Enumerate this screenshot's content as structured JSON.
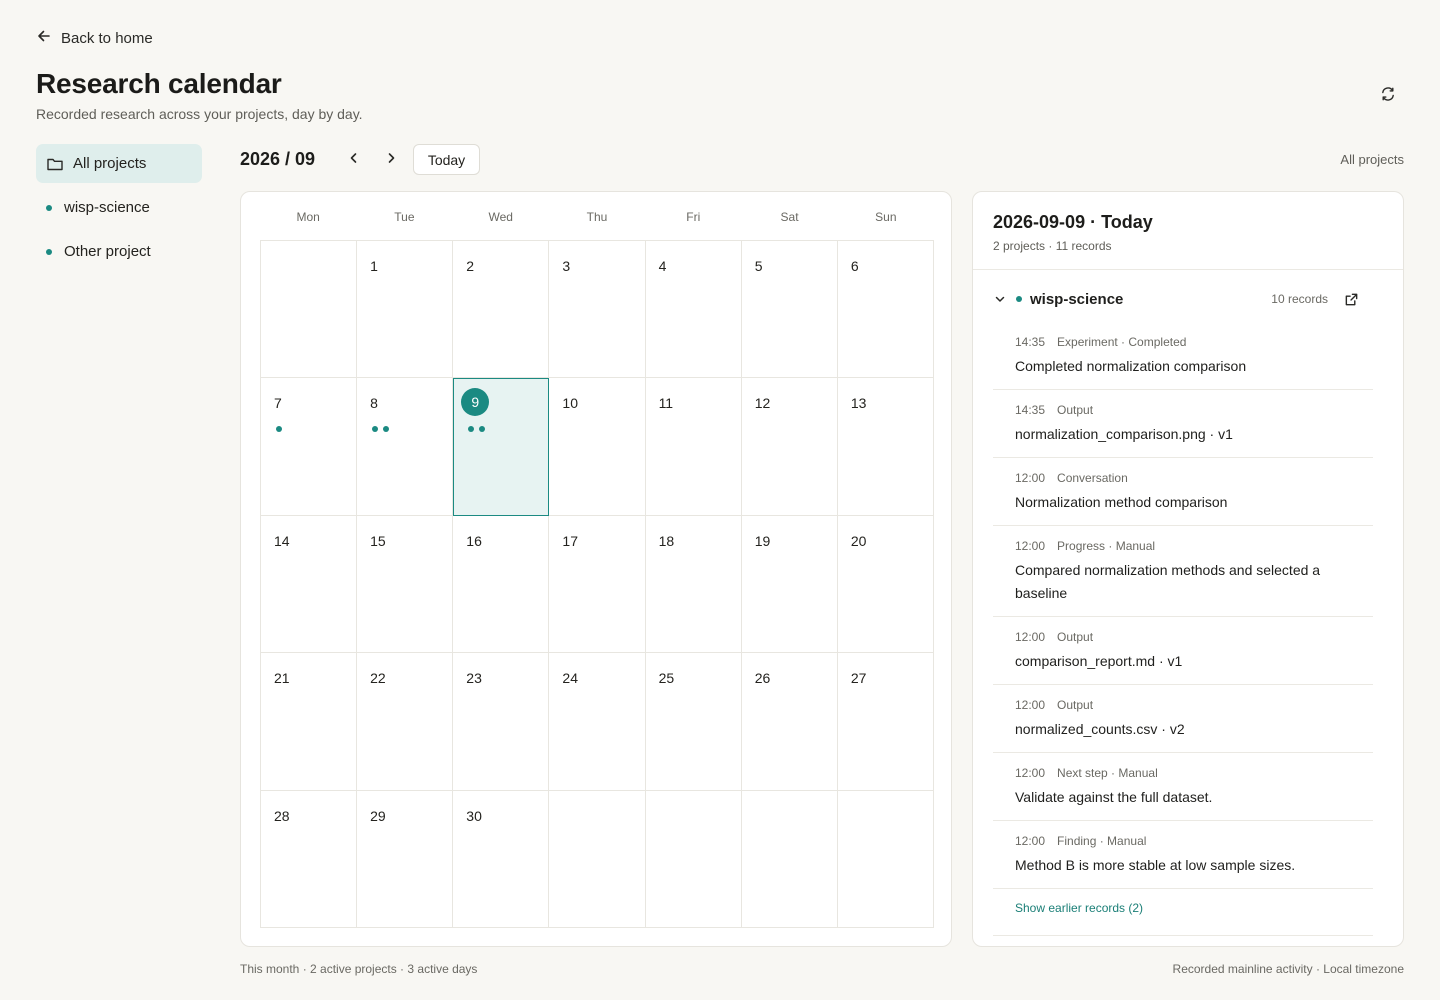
{
  "header": {
    "back_label": "Back to home",
    "title": "Research calendar",
    "subtitle": "Recorded research across your projects, day by day."
  },
  "sidebar": {
    "items": [
      {
        "label": "All projects",
        "active": true,
        "icon": "folder-icon"
      },
      {
        "label": "wisp-science",
        "active": false,
        "icon": "dot"
      },
      {
        "label": "Other project",
        "active": false,
        "icon": "dot"
      }
    ]
  },
  "toolbar": {
    "month_label": "2026 / 09",
    "today_label": "Today",
    "scope_label": "All projects"
  },
  "calendar": {
    "weekdays": [
      "Mon",
      "Tue",
      "Wed",
      "Thu",
      "Fri",
      "Sat",
      "Sun"
    ],
    "cells": [
      {
        "day": "",
        "dots": 0
      },
      {
        "day": "1",
        "dots": 0
      },
      {
        "day": "2",
        "dots": 0
      },
      {
        "day": "3",
        "dots": 0
      },
      {
        "day": "4",
        "dots": 0
      },
      {
        "day": "5",
        "dots": 0
      },
      {
        "day": "6",
        "dots": 0
      },
      {
        "day": "7",
        "dots": 1
      },
      {
        "day": "8",
        "dots": 2
      },
      {
        "day": "9",
        "dots": 2,
        "today": true,
        "selected": true
      },
      {
        "day": "10",
        "dots": 0
      },
      {
        "day": "11",
        "dots": 0
      },
      {
        "day": "12",
        "dots": 0
      },
      {
        "day": "13",
        "dots": 0
      },
      {
        "day": "14",
        "dots": 0
      },
      {
        "day": "15",
        "dots": 0
      },
      {
        "day": "16",
        "dots": 0
      },
      {
        "day": "17",
        "dots": 0
      },
      {
        "day": "18",
        "dots": 0
      },
      {
        "day": "19",
        "dots": 0
      },
      {
        "day": "20",
        "dots": 0
      },
      {
        "day": "21",
        "dots": 0
      },
      {
        "day": "22",
        "dots": 0
      },
      {
        "day": "23",
        "dots": 0
      },
      {
        "day": "24",
        "dots": 0
      },
      {
        "day": "25",
        "dots": 0
      },
      {
        "day": "26",
        "dots": 0
      },
      {
        "day": "27",
        "dots": 0
      },
      {
        "day": "28",
        "dots": 0
      },
      {
        "day": "29",
        "dots": 0
      },
      {
        "day": "30",
        "dots": 0
      },
      {
        "day": "",
        "dots": 0
      },
      {
        "day": "",
        "dots": 0
      },
      {
        "day": "",
        "dots": 0
      },
      {
        "day": "",
        "dots": 0
      }
    ],
    "footer_left": "This month · 2 active projects · 3 active days",
    "footer_right": "Recorded mainline activity · Local timezone"
  },
  "detail": {
    "title": "2026-09-09 · Today",
    "subtitle": "2 projects · 11 records",
    "project": {
      "name": "wisp-science",
      "count": "10 records"
    },
    "records": [
      {
        "time": "14:35",
        "type": "Experiment · Completed",
        "title": "Completed normalization comparison"
      },
      {
        "time": "14:35",
        "type": "Output",
        "title": "normalization_comparison.png · v1"
      },
      {
        "time": "12:00",
        "type": "Conversation",
        "title": "Normalization method comparison"
      },
      {
        "time": "12:00",
        "type": "Progress · Manual",
        "title": "Compared normalization methods and selected a baseline"
      },
      {
        "time": "12:00",
        "type": "Output",
        "title": "comparison_report.md · v1"
      },
      {
        "time": "12:00",
        "type": "Output",
        "title": "normalized_counts.csv · v2"
      },
      {
        "time": "12:00",
        "type": "Next step · Manual",
        "title": "Validate against the full dataset."
      },
      {
        "time": "12:00",
        "type": "Finding · Manual",
        "title": "Method B is more stable at low sample sizes."
      }
    ],
    "show_earlier": "Show earlier records (2)"
  },
  "colors": {
    "accent": "#1b8a82",
    "selected_bg": "#e7f3f2",
    "page_bg": "#f8f7f3"
  }
}
